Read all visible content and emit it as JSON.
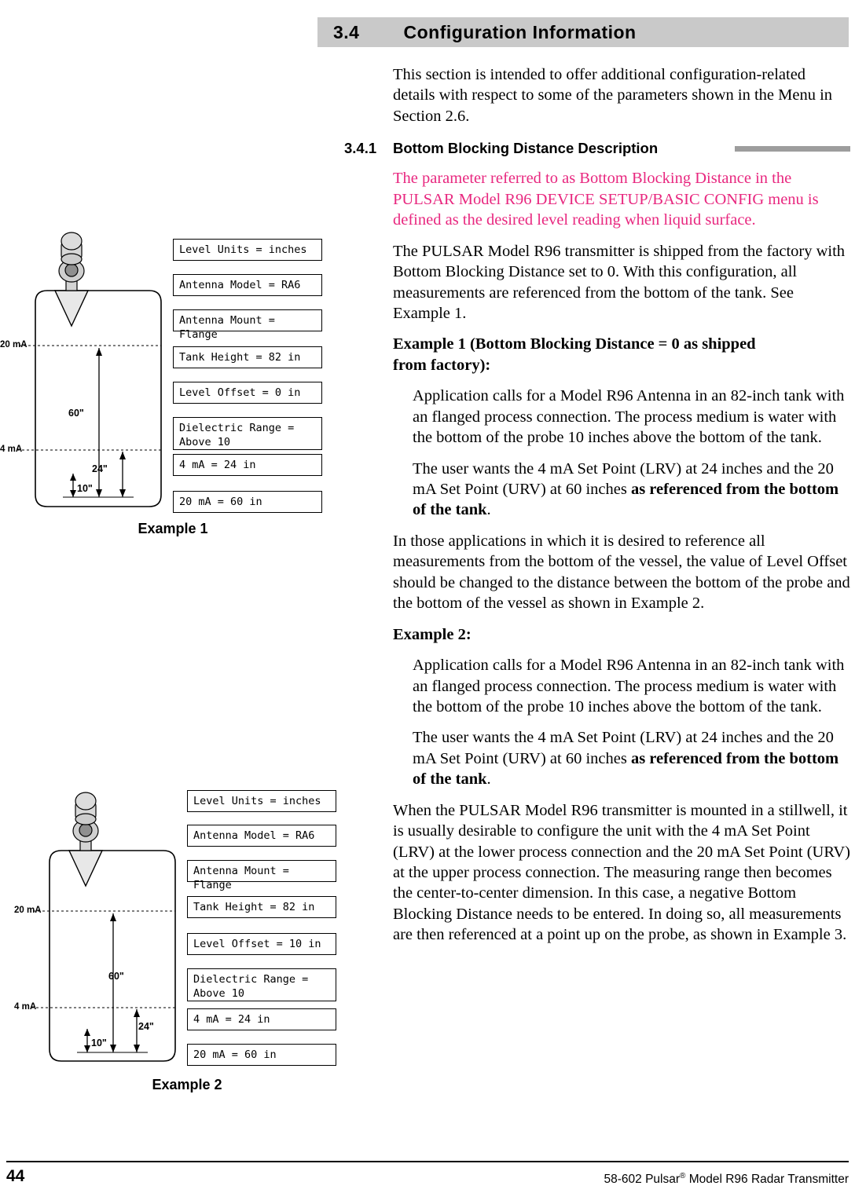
{
  "header": {
    "number": "3.4",
    "title": "Configuration Information"
  },
  "body": {
    "intro": "This section is intended to offer additional configuration-related details with respect to some of the parameters shown in the Menu in Section 2.6.",
    "subsection": {
      "number": "3.4.1",
      "title": "Bottom Blocking Distance Description"
    },
    "pink_paragraph": "The parameter referred to as Bottom Blocking Distance in the PULSAR Model R96 DEVICE SETUP/BASIC CONFIG menu is defined as the desired level reading when liquid surface.",
    "para_shipped": "The PULSAR Model R96 transmitter is shipped from the factory with Bottom Blocking Distance set to 0. With this configuration, all measurements are referenced from the bottom of the tank. See Example 1.",
    "example1_heading_line1": "Example 1 (Bottom Blocking Distance = 0 as shipped",
    "example1_heading_line2": "from factory):",
    "example1_para1": "Application calls for a Model R96 Antenna in an 82-inch tank with an flanged process connection. The process medium is water with the bottom of the probe 10 inches above the bottom of the tank.",
    "example1_para2_pre": "The user wants the 4 mA Set Point (LRV) at 24 inches and the 20 mA Set Point (URV) at 60 inches ",
    "example1_para2_bold": "as referenced from the bottom of the tank",
    "example1_para2_post": ".",
    "para_inthose": "In those applications in which it is desired to reference all measurements from the bottom of the vessel, the value of Level Offset should be changed to the distance between the bottom of the probe and the bottom of the vessel as shown in Example 2.",
    "example2_heading": "Example 2:",
    "example2_para1": "Application calls for a Model R96 Antenna in an 82-inch tank with an flanged process connection. The process medium is water with the bottom of the probe 10 inches above the bottom of the tank.",
    "example2_para2_pre": "The user wants the 4 mA Set Point (LRV) at 24 inches and the 20 mA Set Point (URV) at 60 inches ",
    "example2_para2_bold": "as referenced from the bottom of the tank",
    "example2_para2_post": ".",
    "para_stillwell": "When the PULSAR Model R96 transmitter is mounted in a stillwell, it is usually desirable to configure the unit with the 4 mA Set Point (LRV) at the lower process connection and the 20 mA Set Point (URV) at the upper process connection. The measuring range then becomes the center-to-center dimension. In this case, a negative Bottom Blocking Distance needs to be entered. In doing so, all measurements are then referenced at a point up on the probe, as shown in Example 3."
  },
  "figure1": {
    "caption": "Example 1",
    "params": [
      "Level Units = inches",
      "Antenna Model = RA6",
      "Antenna Mount = Flange",
      "Tank Height = 82 in",
      "Level Offset = 0 in",
      "Dielectric Range =\nAbove 10",
      "4 mA = 24 in",
      "20 mA = 60 in"
    ],
    "labels": {
      "ma20": "20 mA",
      "ma4": "4 mA",
      "dim60": "60\"",
      "dim24": "24\"",
      "dim10": "10\""
    }
  },
  "figure2": {
    "caption": "Example 2",
    "params": [
      "Level Units = inches",
      "Antenna Model = RA6",
      "Antenna Mount = Flange",
      "Tank Height = 82 in",
      "Level Offset = 10 in",
      "Dielectric Range =\nAbove 10",
      "4 mA = 24 in",
      "20 mA = 60 in"
    ],
    "labels": {
      "ma20": "20 mA",
      "ma4": "4 mA",
      "dim60": "60\"",
      "dim24": "24\"",
      "dim10": "10\""
    }
  },
  "footer": {
    "page_number": "44",
    "text_pre": "58-602 Pulsar",
    "text_sup": "®",
    "text_post": " Model R96 Radar Transmitter"
  }
}
